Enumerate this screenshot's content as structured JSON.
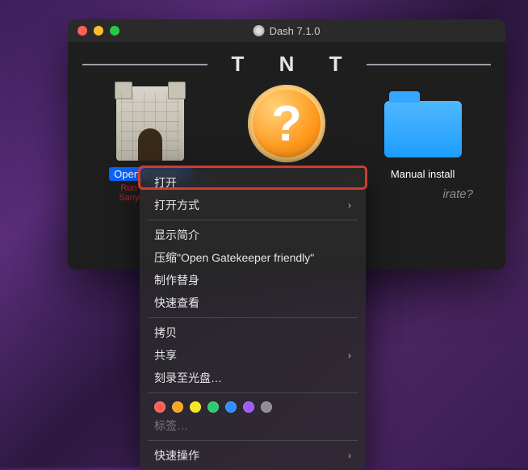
{
  "window": {
    "title": "Dash 7.1.0"
  },
  "header": {
    "brand": "T N T"
  },
  "icons": {
    "gatekeeper": {
      "label": "Open Gateke…",
      "sub1": "Run with Ctrl…",
      "sub2": "Sanyon: Ctrl+…"
    },
    "help": {
      "glyph": "?"
    },
    "folder": {
      "label": "Manual install"
    }
  },
  "footer": {
    "text": "irate?"
  },
  "menu": {
    "open": "打开",
    "open_with": "打开方式",
    "get_info": "显示简介",
    "compress": "压缩\"Open Gatekeeper friendly\"",
    "make_alias": "制作替身",
    "quick_look": "快速查看",
    "copy": "拷贝",
    "share": "共享",
    "burn": "刻录至光盘…",
    "tags_label": "标签…",
    "quick_actions": "快速操作"
  },
  "tag_colors": [
    "#ff5f57",
    "#f5a623",
    "#f8e71c",
    "#2dcb70",
    "#2e90ff",
    "#a259ff",
    "#8e8e93"
  ]
}
